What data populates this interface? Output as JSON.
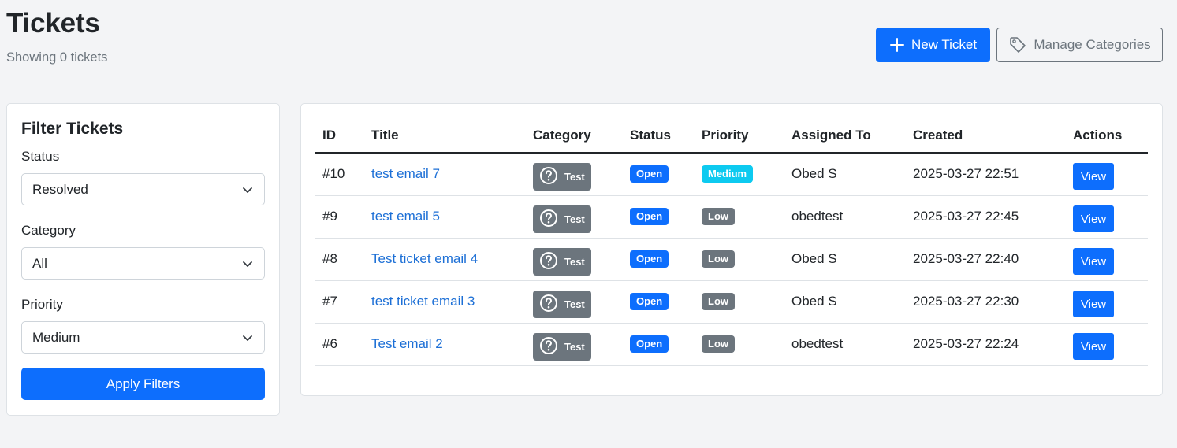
{
  "header": {
    "title": "Tickets",
    "subtitle": "Showing 0 tickets",
    "new_ticket_label": "New Ticket",
    "manage_categories_label": "Manage Categories"
  },
  "filters": {
    "title": "Filter Tickets",
    "status_label": "Status",
    "status_value": "Resolved",
    "category_label": "Category",
    "category_value": "All",
    "priority_label": "Priority",
    "priority_value": "Medium",
    "apply_label": "Apply Filters"
  },
  "table": {
    "columns": [
      "ID",
      "Title",
      "Category",
      "Status",
      "Priority",
      "Assigned To",
      "Created",
      "Actions"
    ],
    "rows": [
      {
        "id": "#10",
        "title": "test email 7",
        "category": "Test",
        "status": "Open",
        "priority": "Medium",
        "assigned": "Obed S",
        "created": "2025-03-27 22:51",
        "action": "View"
      },
      {
        "id": "#9",
        "title": "test email 5",
        "category": "Test",
        "status": "Open",
        "priority": "Low",
        "assigned": "obedtest",
        "created": "2025-03-27 22:45",
        "action": "View"
      },
      {
        "id": "#8",
        "title": "Test ticket email 4",
        "category": "Test",
        "status": "Open",
        "priority": "Low",
        "assigned": "Obed S",
        "created": "2025-03-27 22:40",
        "action": "View"
      },
      {
        "id": "#7",
        "title": "test ticket email 3",
        "category": "Test",
        "status": "Open",
        "priority": "Low",
        "assigned": "Obed S",
        "created": "2025-03-27 22:30",
        "action": "View"
      },
      {
        "id": "#6",
        "title": "Test email 2",
        "category": "Test",
        "status": "Open",
        "priority": "Low",
        "assigned": "obedtest",
        "created": "2025-03-27 22:24",
        "action": "View"
      }
    ]
  },
  "colors": {
    "primary": "#0d6efd",
    "secondary": "#6c757d",
    "info": "#0dcaf0",
    "link": "#1c6fd6"
  },
  "icons": {
    "new_ticket": "plus-icon",
    "manage_categories": "tag-icon",
    "category": "question-circle-icon",
    "select": "chevron-down-icon"
  }
}
